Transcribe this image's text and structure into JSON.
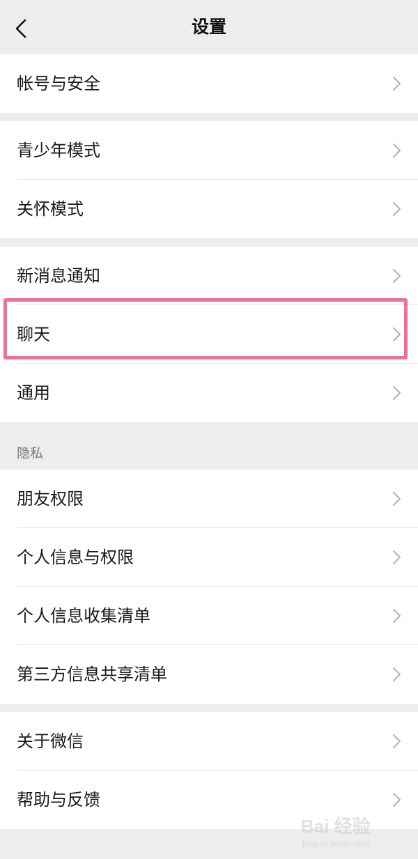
{
  "header": {
    "title": "设置",
    "back_icon": "chevron-left-icon"
  },
  "groups": [
    {
      "items": [
        {
          "label": "帐号与安全"
        }
      ]
    },
    {
      "items": [
        {
          "label": "青少年模式"
        },
        {
          "label": "关怀模式"
        }
      ]
    },
    {
      "items": [
        {
          "label": "新消息通知"
        },
        {
          "label": "聊天",
          "highlighted": true
        },
        {
          "label": "通用"
        }
      ]
    },
    {
      "section_label": "隐私",
      "items": [
        {
          "label": "朋友权限"
        },
        {
          "label": "个人信息与权限"
        },
        {
          "label": "个人信息收集清单"
        },
        {
          "label": "第三方信息共享清单"
        }
      ]
    },
    {
      "items": [
        {
          "label": "关于微信"
        },
        {
          "label": "帮助与反馈"
        }
      ]
    }
  ],
  "colors": {
    "background": "#ededed",
    "card": "#ffffff",
    "highlight": "#f06e98",
    "text": "#191919",
    "secondary_text": "#7a7a7a"
  },
  "watermark": {
    "brand": "Bai 经验",
    "url": "jingyan.baidu.com"
  }
}
